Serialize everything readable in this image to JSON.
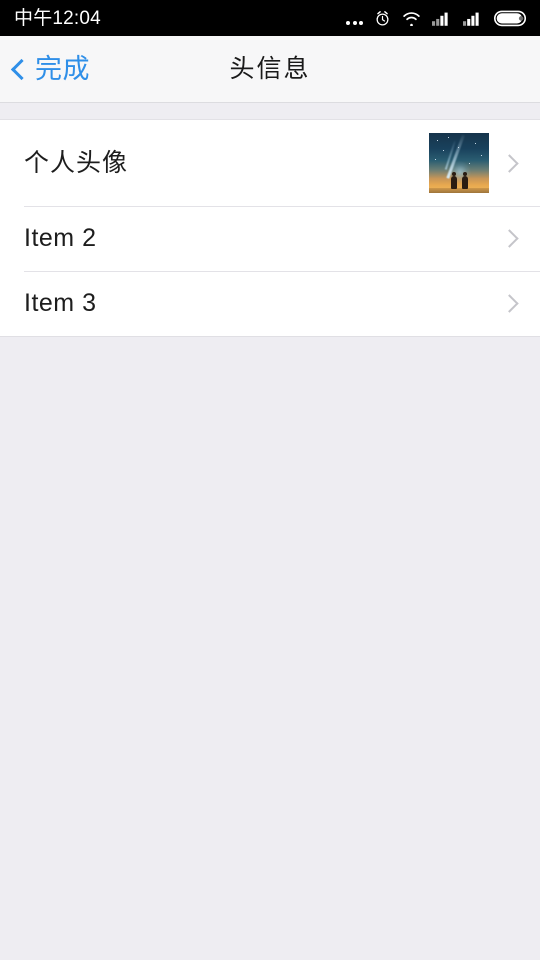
{
  "status_bar": {
    "time": "中午12:04",
    "icons": [
      {
        "name": "more-dots-icon",
        "glyph": "dots"
      },
      {
        "name": "alarm-clock-icon",
        "glyph": "alarm"
      },
      {
        "name": "wifi-icon",
        "glyph": "wifi"
      },
      {
        "name": "signal-sim1-icon",
        "glyph": "signal"
      },
      {
        "name": "signal-sim2-icon",
        "glyph": "signal"
      },
      {
        "name": "battery-icon",
        "glyph": "battery"
      }
    ],
    "background_color": "#000000",
    "text_color": "#ffffff"
  },
  "nav_bar": {
    "back_label": "完成",
    "back_icon": "chevron-left-icon",
    "title": "头信息",
    "accent_color": "#2f8fe8",
    "background_color": "#f7f7f8",
    "title_color": "#1a1a1a"
  },
  "list": {
    "rows": [
      {
        "label": "个人头像",
        "type": "avatar",
        "has_thumbnail": true,
        "thumbnail_alt": "comet-night-sky-silhouette",
        "accessory": "chevron-right-icon"
      },
      {
        "label": "Item 2",
        "type": "plain",
        "has_thumbnail": false,
        "accessory": "chevron-right-icon"
      },
      {
        "label": "Item 3",
        "type": "plain",
        "has_thumbnail": false,
        "accessory": "chevron-right-icon"
      }
    ],
    "row_background": "#ffffff",
    "separator_color": "#e3e2e7",
    "label_color": "#1d1d1d",
    "chevron_color": "#c5c5ca"
  },
  "page": {
    "background_color": "#eeedf2"
  }
}
